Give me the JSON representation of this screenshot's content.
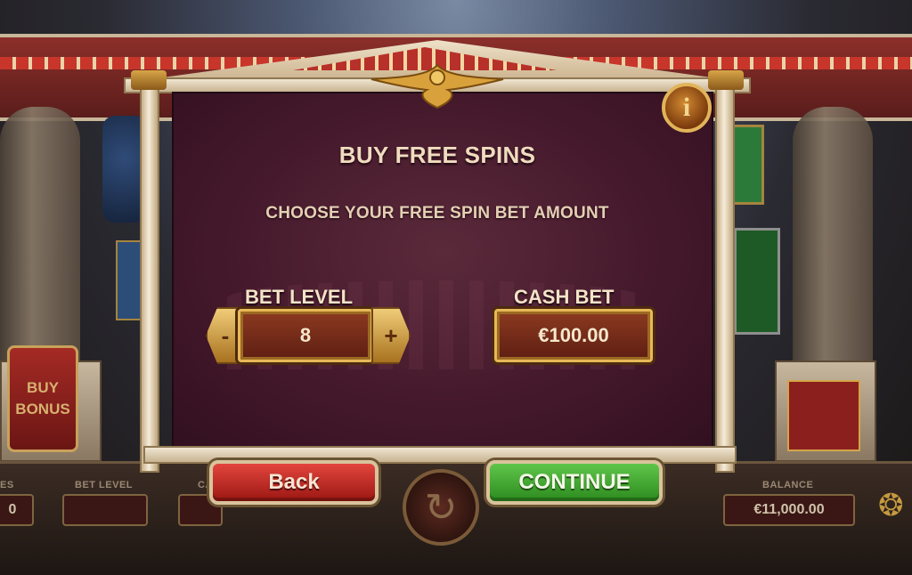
{
  "background": {
    "buy_bonus_label": "BUY BONUS",
    "hud": {
      "free_spins_label_partial": "ES",
      "free_spins_value_partial": "0",
      "bet_level_label": "BET LEVEL",
      "cash_bet_label_partial": "CA",
      "balance_label": "BALANCE",
      "balance_value": "€11,000.00"
    }
  },
  "dialog": {
    "title": "BUY FREE SPINS",
    "subtitle": "CHOOSE YOUR FREE SPIN BET AMOUNT",
    "info_label": "i",
    "bet_level": {
      "label": "BET LEVEL",
      "value": "8",
      "decrement_label": "-",
      "increment_label": "+"
    },
    "cash_bet": {
      "label": "CASH BET",
      "value": "€100.00"
    },
    "back_label": "Back",
    "continue_label": "CONTINUE"
  },
  "icons": {
    "spin": "refresh-icon",
    "menu": "ornament-menu-icon",
    "eagle": "eagle-emblem-icon",
    "info": "info-icon"
  },
  "colors": {
    "back_button": "#c62a22",
    "continue_button": "#46a834",
    "panel": "#45192c",
    "gold": "#e7b857"
  }
}
